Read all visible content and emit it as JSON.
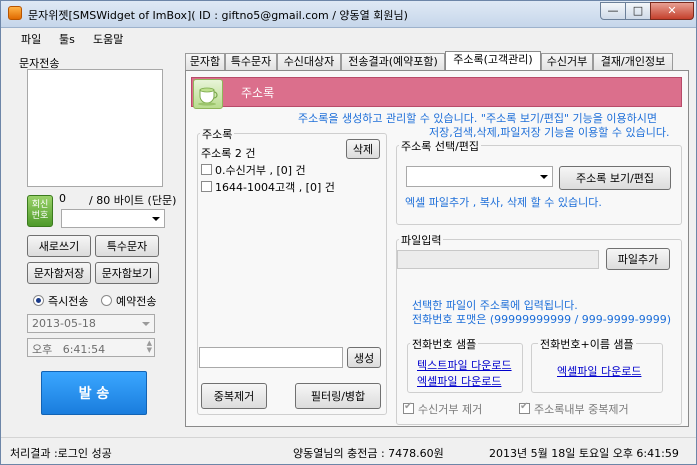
{
  "window": {
    "title": "문자위젯[SMSWidget of ImBox]( ID : giftno5@gmail.com / 양동열 회원님)",
    "min_symbol": "—",
    "max_symbol": "□",
    "close_symbol": "✕"
  },
  "menu": [
    "파일",
    "툴s",
    "도움말"
  ],
  "left": {
    "section_label": "문자전송",
    "callback_button": "회신\n번호",
    "byte_count": "0",
    "byte_limit": "/ 80 바이트 (단문)",
    "buttons": {
      "new_write": "새로쓰기",
      "special_chars": "특수문자",
      "save_to_box": "문자함저장",
      "view_box": "문자함보기"
    },
    "send_mode": {
      "now": "즉시전송",
      "reserve": "예약전송",
      "selected": "now"
    },
    "date_value": "2013-05-18",
    "time_value": "오후   6:41:54",
    "send_button": "발  송"
  },
  "tabs": [
    {
      "label": "문자함",
      "active": false
    },
    {
      "label": "특수문자",
      "active": false
    },
    {
      "label": "수신대상자",
      "active": false
    },
    {
      "label": "전송결과(예약포함)",
      "active": false
    },
    {
      "label": "주소록(고객관리)",
      "active": true
    },
    {
      "label": "수신거부",
      "active": false
    },
    {
      "label": "결재/개인정보",
      "active": false
    }
  ],
  "address": {
    "header_title": "주소록",
    "description_1": "주소록을 생성하고 관리할 수 있습니다. \"주소록 보기/편집\" 기능을 이용하시면",
    "description_2": "저장,검색,삭제,파일저장 기능을 이용할 수 있습니다.",
    "list_group_label": "주소록",
    "count_text": "주소록 2 건",
    "delete_button": "삭제",
    "items": [
      {
        "label": "0.수신거부 , [0] 건",
        "checked": false
      },
      {
        "label": "1644-1004고객 , [0] 건",
        "checked": false
      }
    ],
    "create_input_value": "",
    "create_button": "생성",
    "dedupe_button": "중복제거",
    "filter_merge_button": "필터링/병합",
    "select_group_label": "주소록 선택/편집",
    "select_value": "",
    "view_edit_button": "주소록 보기/편집",
    "select_hint": "엑셀 파일추가 , 복사, 삭제  할 수 있습니다.",
    "file_group_label": "파일입력",
    "file_path_value": "",
    "file_add_button": "파일추가",
    "file_hint_1": "선택한 파일이 주소록에 입력됩니다.",
    "file_hint_2": "전화번호 포맷은 (99999999999 / 999-9999-9999)",
    "phone_sample_label": "전화번호 샘플",
    "text_file_download": "텍스트파일 다운로드",
    "excel_file_download": "엑셀파일 다운로드",
    "phone_name_sample_label": "전화번호+이름 샘플",
    "excel_file_download_2": "엑셀파일 다운로드",
    "exclude_reject_label": "수신거부 제거",
    "exclude_reject_checked": true,
    "dedupe_internal_label": "주소록내부 중복제거",
    "dedupe_internal_checked": true
  },
  "status": {
    "result": "처리결과 :로그인 성공",
    "balance": "양동열님의 충전금 : 7478.60원",
    "datetime": "2013년 5월 18일 토요일 오후 6:41:59"
  },
  "colors": {
    "header_pink": "#db6f8c",
    "send_blue": "#1e8ff0",
    "hint_blue": "#1e6fd9",
    "link_blue": "#0000cc"
  },
  "icons": {
    "header_icon": "tea-cup-icon",
    "app_icon": "sms-widget-icon"
  }
}
